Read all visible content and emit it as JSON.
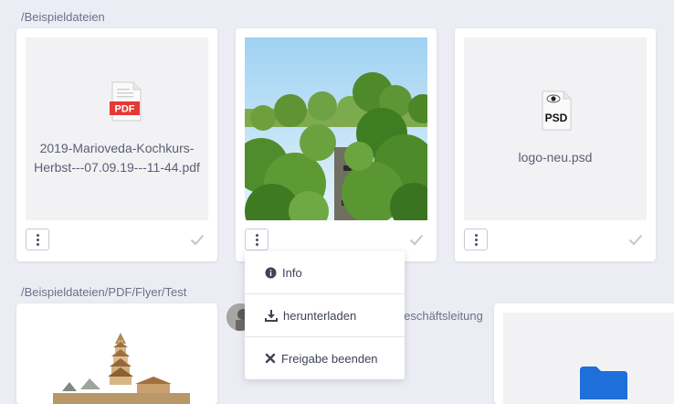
{
  "folders": {
    "first": "/Beispieldateien",
    "second": "/Beispieldateien/PDF/Flyer/Test"
  },
  "files": [
    {
      "name_line1": "2019-Marioveda-Kochkurs-",
      "name_line2": "Herbst---07.09.19---11-44.pdf",
      "badge": "PDF",
      "icon": "pdf-file-icon"
    },
    {
      "name": "",
      "icon": "photo-trees"
    },
    {
      "name": "logo-neu.psd",
      "badge": "PSD",
      "icon": "psd-file-icon"
    }
  ],
  "context_menu": {
    "items": [
      {
        "label": "Info",
        "icon": "info-icon"
      },
      {
        "label": "herunterladen",
        "icon": "download-icon"
      },
      {
        "label": "Freigabe beenden",
        "icon": "close-icon"
      }
    ]
  },
  "share_row": {
    "label": "Geschäftsleitung"
  },
  "colors": {
    "background": "#ecedf4",
    "pdf_red": "#e53935",
    "folder_blue": "#1e6fd9",
    "check_gray": "#c3c5cf"
  }
}
